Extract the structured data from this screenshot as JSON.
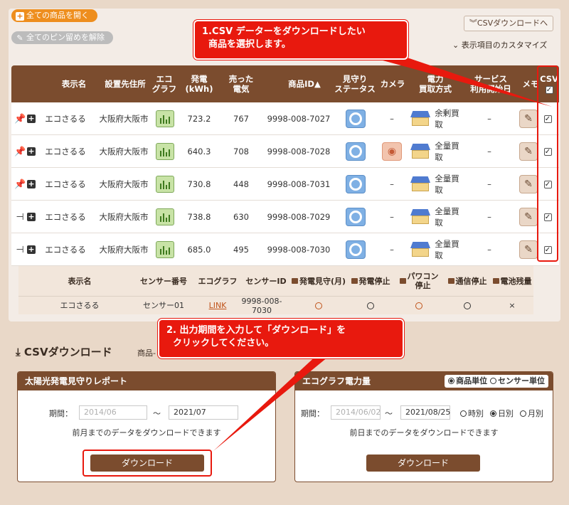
{
  "toolbar": {
    "open_all": "全ての商品を開く",
    "unpin_all": "全てのピン留めを解除",
    "csv_download_link": "CSVダウンロードへ",
    "customize": "表示項目のカスタマイズ"
  },
  "table": {
    "headers": {
      "name": "表示名",
      "address": "設置先住所",
      "ecograph": "エコ\nグラフ",
      "generation": "発電\n(kWh)",
      "sold": "売った\n電気",
      "product_id": "商品ID▲",
      "watch_status": "見守り\nステータス",
      "camera": "カメラ",
      "purchase": "電力\n買取方式",
      "service_start": "サービス\n利用開始日",
      "memo": "メモ",
      "csv": "CSV"
    },
    "rows": [
      {
        "pin": "pinned",
        "name": "エコさるる",
        "address": "大阪府大阪市",
        "generation": "723.2",
        "sold": "767",
        "product_id": "9998-008-7027",
        "camera": "–",
        "purchase": "余剰買取",
        "service_start": "–",
        "csv_checked": true
      },
      {
        "pin": "pinned",
        "name": "エコさるる",
        "address": "大阪府大阪市",
        "generation": "640.3",
        "sold": "708",
        "product_id": "9998-008-7028",
        "camera": "camera-icon",
        "purchase": "全量買取",
        "service_start": "–",
        "csv_checked": true
      },
      {
        "pin": "pinned",
        "name": "エコさるる",
        "address": "大阪府大阪市",
        "generation": "730.8",
        "sold": "448",
        "product_id": "9998-008-7031",
        "camera": "–",
        "purchase": "全量買取",
        "service_start": "–",
        "csv_checked": true
      },
      {
        "pin": "unpinned",
        "name": "エコさるる",
        "address": "大阪府大阪市",
        "generation": "738.8",
        "sold": "630",
        "product_id": "9998-008-7029",
        "camera": "–",
        "purchase": "全量買取",
        "service_start": "–",
        "csv_checked": true
      },
      {
        "pin": "unpinned",
        "name": "エコさるる",
        "address": "大阪府大阪市",
        "generation": "685.0",
        "sold": "495",
        "product_id": "9998-008-7030",
        "camera": "–",
        "purchase": "全量買取",
        "service_start": "–",
        "csv_checked": true
      }
    ]
  },
  "sensor_table": {
    "headers": {
      "name": "表示名",
      "sensor_no": "センサー番号",
      "ecograph": "エコグラフ",
      "sensor_id": "センサーID",
      "watch_month": "発電見守(月)",
      "gen_stop": "発電停止",
      "pcs_stop": "パワコン\n停止",
      "comm_stop": "通信停止",
      "battery": "電池残量"
    },
    "row": {
      "name": "エコさるる",
      "sensor_no": "センサー01",
      "ecograph": "LINK",
      "sensor_id": "9998-008-7030",
      "battery": "×"
    }
  },
  "csv_section": {
    "title": "CSVダウンロード",
    "note": "商品-"
  },
  "report_card": {
    "title": "太陽光発電見守りレポート",
    "period_label": "期間：",
    "from_placeholder": "2014/06",
    "tilde": "～",
    "to_value": "2021/07",
    "note": "前月までのデータをダウンロードできます",
    "button": "ダウンロード"
  },
  "power_card": {
    "title": "エコグラフ電力量",
    "unit_product": "商品単位",
    "unit_sensor": "センサー単位",
    "period_label": "期間：",
    "from_placeholder": "2014/06/02",
    "tilde": "～",
    "to_value": "2021/08/25",
    "granularity_hour": "時別",
    "granularity_day": "日別",
    "granularity_month": "月別",
    "note": "前日までのデータをダウンロードできます",
    "button": "ダウンロード"
  },
  "callouts": {
    "step1": "1.CSV データーをダウンロードしたい\n  商品を選択します。",
    "step2": "2. 出力期間を入力して「ダウンロード」を\n  クリックしてください。"
  },
  "colors": {
    "header_brown": "#7b4c2e",
    "accent_orange": "#ee8e1e",
    "callout_red": "#e8190e",
    "watch_blue": "#7fb0e4"
  }
}
